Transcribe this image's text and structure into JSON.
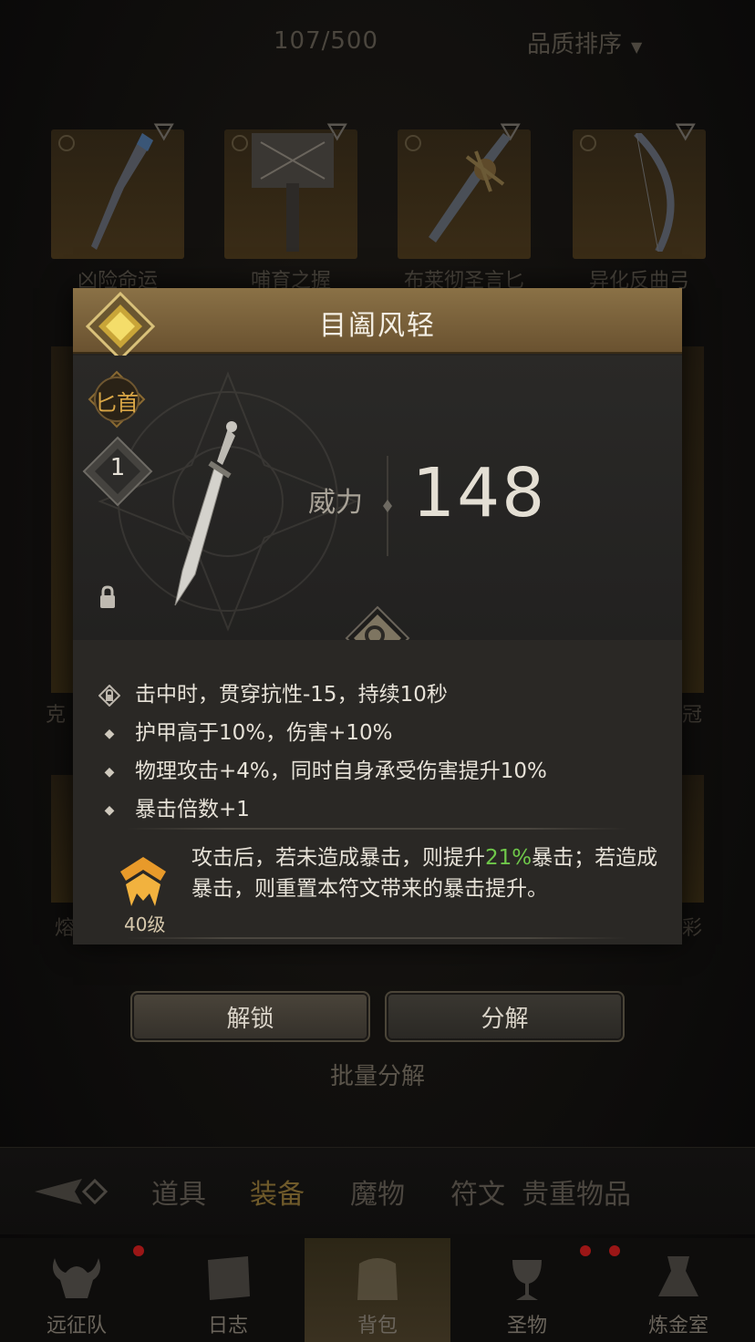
{
  "inventory": {
    "count": "107/500",
    "sort_label": "品质排序",
    "items": [
      {
        "name": "凶险命运"
      },
      {
        "name": "哺育之握"
      },
      {
        "name": "布莱彻圣言匕"
      },
      {
        "name": "异化反曲弓"
      }
    ],
    "partial_left": [
      "克",
      "熔"
    ],
    "partial_right": [
      "冠",
      "彩"
    ]
  },
  "actions": {
    "unlock": "解锁",
    "decompose": "分解",
    "batch_decompose": "批量分解"
  },
  "categories": {
    "items": [
      "道具",
      "装备",
      "魔物",
      "符文",
      "贵重物品"
    ],
    "active": "装备"
  },
  "bottom_nav": [
    {
      "label": "远征队",
      "badge": true
    },
    {
      "label": "日志",
      "badge": false
    },
    {
      "label": "背包",
      "badge": false,
      "active": true
    },
    {
      "label": "圣物",
      "badge": true
    },
    {
      "label": "炼金室",
      "badge": true
    }
  ],
  "detail": {
    "title": "目阖风轻",
    "type": "匕首",
    "level": "1",
    "power_label": "威力",
    "power_value": "148",
    "attributes": [
      "击中时，贯穿抗性-15，持续10秒",
      "护甲高于10%，伤害+10%",
      "物理攻击+4%，同时自身承受伤害提升10%",
      "暴击倍数+1"
    ],
    "rune": {
      "level": "40级",
      "desc_part1": "攻击后，若未造成暴击，则提升",
      "desc_highlight": "21%",
      "desc_part2": "暴击；若造成暴击，则重置本符文带来的暴击提升。"
    }
  },
  "colors": {
    "accent_gold": "#8a7146",
    "highlight_green": "#6fc84a",
    "badge_red": "#9b1616"
  }
}
